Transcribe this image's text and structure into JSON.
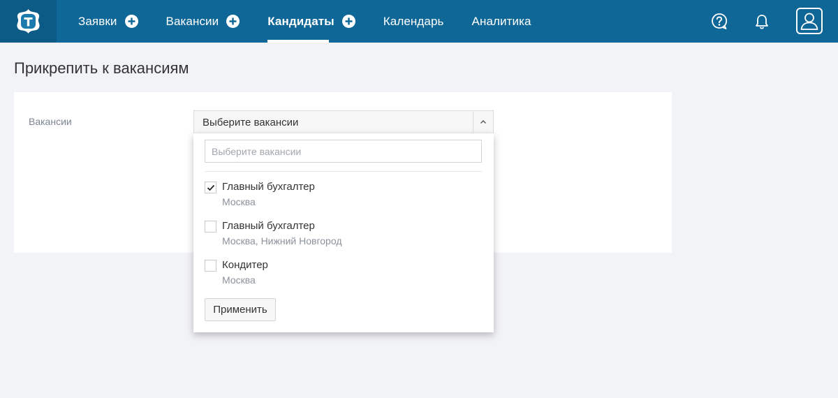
{
  "header": {
    "nav": [
      {
        "label": "Заявки",
        "has_add": true
      },
      {
        "label": "Вакансии",
        "has_add": true
      },
      {
        "label": "Кандидаты",
        "has_add": true,
        "active": true
      },
      {
        "label": "Календарь",
        "has_add": false
      },
      {
        "label": "Аналитика",
        "has_add": false
      }
    ],
    "icons": [
      "logo-icon",
      "help-icon",
      "bell-icon",
      "profile-icon"
    ],
    "colors": {
      "bar": "#0f6797",
      "logo_block": "#0c5a86",
      "text": "#ffffff"
    }
  },
  "page": {
    "title": "Прикрепить к вакансиям"
  },
  "form": {
    "vacancies_label": "Вакансии",
    "select_value": "Выберите вакансии"
  },
  "dropdown": {
    "search_placeholder": "Выберите вакансии",
    "options": [
      {
        "title": "Главный бухгалтер",
        "location": "Москва",
        "checked": true
      },
      {
        "title": "Главный бухгалтер",
        "location": "Москва, Нижний Новгород",
        "checked": false
      },
      {
        "title": "Кондитер",
        "location": "Москва",
        "checked": false
      }
    ],
    "apply_label": "Применить"
  }
}
